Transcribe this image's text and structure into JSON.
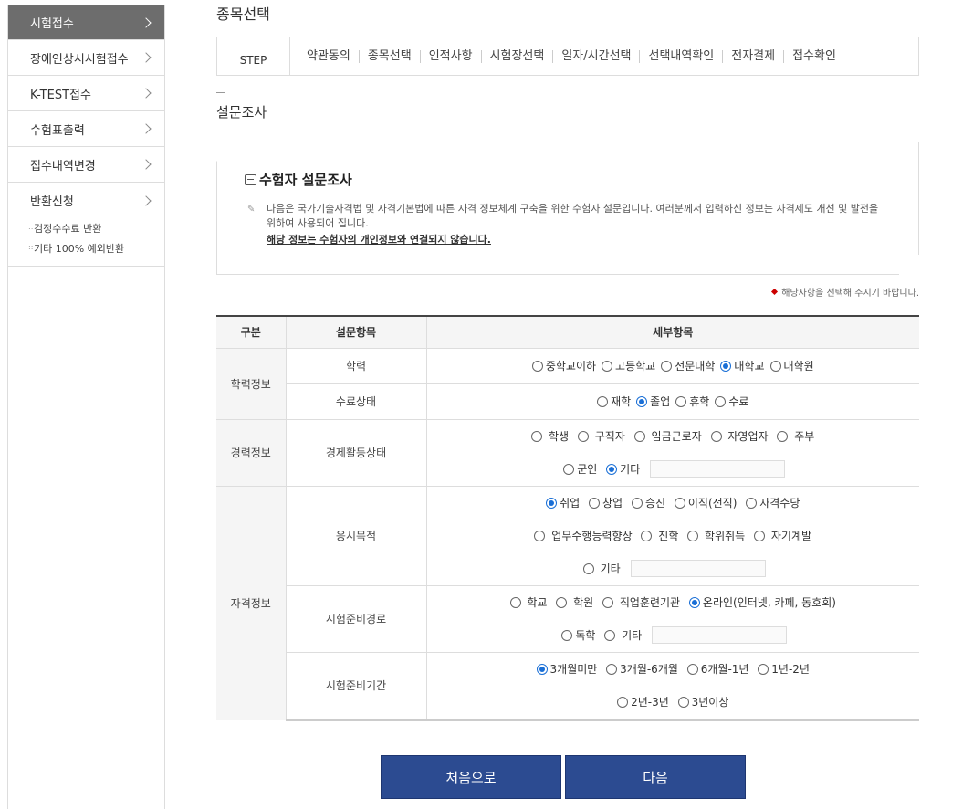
{
  "sidebar": {
    "items": [
      {
        "label": "시험접수"
      },
      {
        "label": "장애인상시시험접수"
      },
      {
        "label": "K-TEST접수"
      },
      {
        "label": "수험표출력"
      },
      {
        "label": "접수내역변경"
      },
      {
        "label": "반환신청"
      }
    ],
    "subitems": [
      {
        "label": "검정수수료 반환"
      },
      {
        "label": "기타 100% 예외반환"
      }
    ]
  },
  "page": {
    "title": "종목선택",
    "section_title": "설문조사"
  },
  "steps": {
    "label": "STEP",
    "items": [
      "약관동의",
      "종목선택",
      "인적사항",
      "시험장선택",
      "일자/시간선택",
      "선택내역확인",
      "전자결제",
      "접수확인"
    ]
  },
  "info": {
    "title": "수험자 설문조사",
    "text": "다음은 국가기술자격법 및 자격기본법에 따른 자격 정보체계 구축을 위한 수험자 설문입니다. 여러분께서 입력하신 정보는 자격제도 개선 및 발전을 위하여 사용되어 집니다.",
    "emphasis": "해당 정보는 수험자의 개인정보와 연결되지 않습니다."
  },
  "notice": "해당사항을 선택해 주시기 바랍니다.",
  "table": {
    "headers": [
      "구분",
      "설문항목",
      "세부항목"
    ],
    "categories": [
      "학력정보",
      "경력정보",
      "자격정보"
    ],
    "items": {
      "education": "학력",
      "graduation": "수료상태",
      "economic": "경제활동상태",
      "purpose": "응시목적",
      "prep_route": "시험준비경로",
      "prep_period": "시험준비기간"
    },
    "education_opts": [
      "중학교이하",
      "고등학교",
      "전문대학",
      "대학교",
      "대학원"
    ],
    "graduation_opts": [
      "재학",
      "졸업",
      "휴학",
      "수료"
    ],
    "economic_opts": [
      "학생",
      "구직자",
      "임금근로자",
      "자영업자",
      "주부",
      "군인",
      "기타"
    ],
    "purpose_opts": [
      "취업",
      "창업",
      "승진",
      "이직(전직)",
      "자격수당",
      "업무수행능력향상",
      "진학",
      "학위취득",
      "자기계발",
      "기타"
    ],
    "route_opts": [
      "학교",
      "학원",
      "직업훈련기관",
      "온라인(인터넷, 카페, 동호회)",
      "독학",
      "기타"
    ],
    "period_opts": [
      "3개월미만",
      "3개월-6개월",
      "6개월-1년",
      "1년-2년",
      "2년-3년",
      "3년이상"
    ]
  },
  "buttons": {
    "first": "처음으로",
    "next": "다음"
  }
}
